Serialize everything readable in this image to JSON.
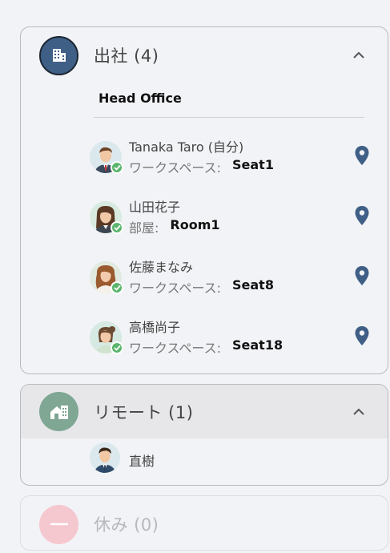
{
  "groups": {
    "office": {
      "title": "出社 (4)",
      "icon": "office-building-icon",
      "location": "Head Office",
      "members": [
        {
          "name": "Tanaka Taro (自分)",
          "seat_label": "ワークスペース:",
          "seat_value": "Seat1",
          "status": "checked-in"
        },
        {
          "name": "山田花子",
          "seat_label": "部屋:",
          "seat_value": "Room1",
          "status": "checked-in"
        },
        {
          "name": "佐藤まなみ",
          "seat_label": "ワークスペース:",
          "seat_value": "Seat8",
          "status": "checked-in"
        },
        {
          "name": "高橋尚子",
          "seat_label": "ワークスペース:",
          "seat_value": "Seat18",
          "status": "checked-in"
        }
      ]
    },
    "remote": {
      "title": "リモート (1)",
      "icon": "home-office-icon",
      "members": [
        {
          "name": "直樹"
        }
      ]
    },
    "off": {
      "title": "休み (0)",
      "icon": "minus-circle-icon"
    }
  },
  "colors": {
    "office_icon_bg": "#3f5f86",
    "remote_icon_bg": "#7fa793",
    "off_icon_bg": "#f5c7cf",
    "check_badge": "#5bb56d",
    "pin": "#3f5f86"
  }
}
